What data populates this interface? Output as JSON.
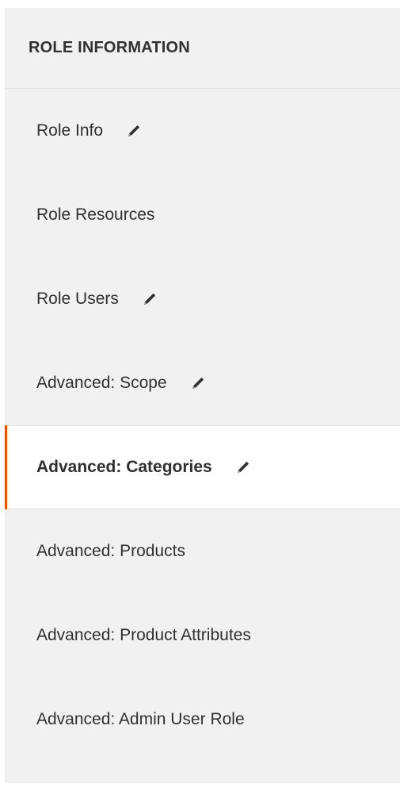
{
  "panel": {
    "title": "ROLE INFORMATION"
  },
  "nav": {
    "items": [
      {
        "label": "Role Info",
        "edited": true,
        "active": false
      },
      {
        "label": "Role Resources",
        "edited": false,
        "active": false
      },
      {
        "label": "Role Users",
        "edited": true,
        "active": false
      },
      {
        "label": "Advanced: Scope",
        "edited": true,
        "active": false
      },
      {
        "label": "Advanced: Categories",
        "edited": true,
        "active": true
      },
      {
        "label": "Advanced: Products",
        "edited": false,
        "active": false
      },
      {
        "label": "Advanced: Product Attributes",
        "edited": false,
        "active": false
      },
      {
        "label": "Advanced: Admin User Role",
        "edited": false,
        "active": false
      }
    ]
  },
  "icons": {
    "edit": "pencil-icon"
  },
  "colors": {
    "active_accent": "#eb5202",
    "panel_background": "#f1f1f1",
    "active_background": "#ffffff"
  }
}
